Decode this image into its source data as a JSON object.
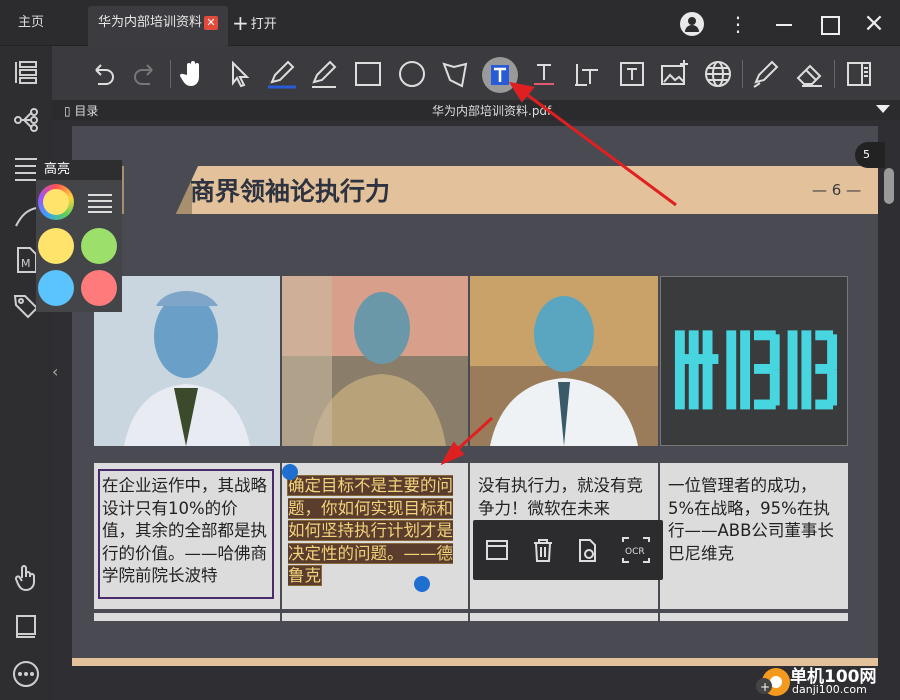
{
  "tabs": {
    "home": "主页",
    "document": "华为内部培训资料",
    "open": "打开"
  },
  "docbar": {
    "toc": "目录",
    "filename": "华为内部培训资料.pdf"
  },
  "page": {
    "title": "商界领袖论执行力",
    "page_number": "— 6 —",
    "page_badge": "5",
    "logo_text": "ABB",
    "cells": [
      "在企业运作中，其战略设计只有10%的价值，其余的全部都是执行的价值。——哈佛商学院前院长波特",
      "确定目标不是主要的问题，你如何实现目标和如何坚持执行计划才是决定性的问题。——德鲁克",
      "没有执行力，就没有竞争力！微软在未来",
      "一位管理者的成功，5%在战略，95%在执行——ABB公司董事长巴尼维克"
    ]
  },
  "highlight_popup": {
    "title": "高亮",
    "colors": [
      "#ffe36b",
      "#9ce06b",
      "#5bc4ff",
      "#ff7b7b"
    ]
  },
  "context_menu": {
    "ocr_label": "OCR"
  },
  "watermark": {
    "name": "单机100网",
    "url": "danji100.com"
  },
  "colors": {
    "accent_annotation": "#e02020",
    "selection_handle": "#1f6fd0",
    "banner": "#e3c19a"
  }
}
